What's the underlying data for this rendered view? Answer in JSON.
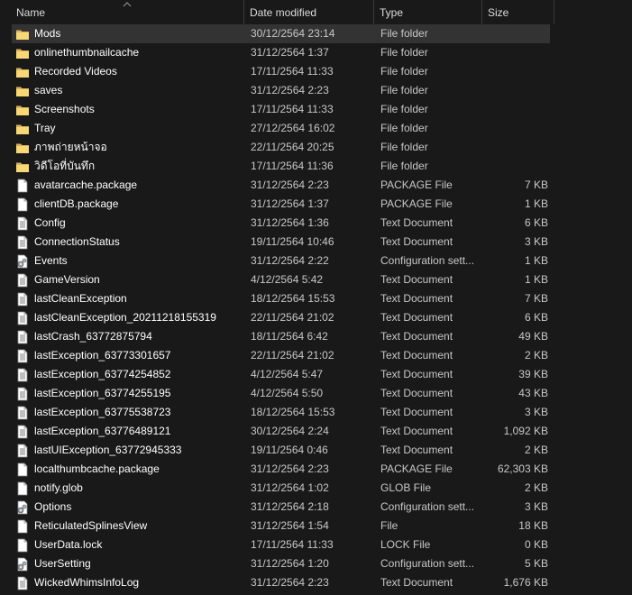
{
  "columns": {
    "name": "Name",
    "date": "Date modified",
    "type": "Type",
    "size": "Size"
  },
  "colors": {
    "background": "#191919",
    "selected_row": "#333333",
    "folder": "#f8d775",
    "file": "#ffffff"
  },
  "files": [
    {
      "name": "Mods",
      "date": "30/12/2564 23:14",
      "type": "File folder",
      "size": "",
      "icon": "folder-icon",
      "selected": true
    },
    {
      "name": "onlinethumbnailcache",
      "date": "31/12/2564 1:37",
      "type": "File folder",
      "size": "",
      "icon": "folder-icon"
    },
    {
      "name": "Recorded Videos",
      "date": "17/11/2564 11:33",
      "type": "File folder",
      "size": "",
      "icon": "folder-icon"
    },
    {
      "name": "saves",
      "date": "31/12/2564 2:23",
      "type": "File folder",
      "size": "",
      "icon": "folder-icon"
    },
    {
      "name": "Screenshots",
      "date": "17/11/2564 11:33",
      "type": "File folder",
      "size": "",
      "icon": "folder-icon"
    },
    {
      "name": "Tray",
      "date": "27/12/2564 16:02",
      "type": "File folder",
      "size": "",
      "icon": "folder-icon"
    },
    {
      "name": "ภาพถ่ายหน้าจอ",
      "date": "22/11/2564 20:25",
      "type": "File folder",
      "size": "",
      "icon": "folder-icon"
    },
    {
      "name": "วิดีโอที่บันทึก",
      "date": "17/11/2564 11:36",
      "type": "File folder",
      "size": "",
      "icon": "folder-icon"
    },
    {
      "name": "avatarcache.package",
      "date": "31/12/2564 2:23",
      "type": "PACKAGE File",
      "size": "7 KB",
      "icon": "file-icon"
    },
    {
      "name": "clientDB.package",
      "date": "31/12/2564 1:37",
      "type": "PACKAGE File",
      "size": "1 KB",
      "icon": "file-icon"
    },
    {
      "name": "Config",
      "date": "31/12/2564 1:36",
      "type": "Text Document",
      "size": "6 KB",
      "icon": "text-document-icon"
    },
    {
      "name": "ConnectionStatus",
      "date": "19/11/2564 10:46",
      "type": "Text Document",
      "size": "3 KB",
      "icon": "text-document-icon"
    },
    {
      "name": "Events",
      "date": "31/12/2564 2:22",
      "type": "Configuration sett...",
      "size": "1 KB",
      "icon": "config-file-icon"
    },
    {
      "name": "GameVersion",
      "date": "4/12/2564 5:42",
      "type": "Text Document",
      "size": "1 KB",
      "icon": "text-document-icon"
    },
    {
      "name": "lastCleanException",
      "date": "18/12/2564 15:53",
      "type": "Text Document",
      "size": "7 KB",
      "icon": "text-document-icon"
    },
    {
      "name": "lastCleanException_20211218155319",
      "date": "22/11/2564 21:02",
      "type": "Text Document",
      "size": "6 KB",
      "icon": "text-document-icon"
    },
    {
      "name": "lastCrash_63772875794",
      "date": "18/11/2564 6:42",
      "type": "Text Document",
      "size": "49 KB",
      "icon": "text-document-icon"
    },
    {
      "name": "lastException_63773301657",
      "date": "22/11/2564 21:02",
      "type": "Text Document",
      "size": "2 KB",
      "icon": "text-document-icon"
    },
    {
      "name": "lastException_63774254852",
      "date": "4/12/2564 5:47",
      "type": "Text Document",
      "size": "39 KB",
      "icon": "text-document-icon"
    },
    {
      "name": "lastException_63774255195",
      "date": "4/12/2564 5:50",
      "type": "Text Document",
      "size": "43 KB",
      "icon": "text-document-icon"
    },
    {
      "name": "lastException_63775538723",
      "date": "18/12/2564 15:53",
      "type": "Text Document",
      "size": "3 KB",
      "icon": "text-document-icon"
    },
    {
      "name": "lastException_63776489121",
      "date": "30/12/2564 2:24",
      "type": "Text Document",
      "size": "1,092 KB",
      "icon": "text-document-icon"
    },
    {
      "name": "lastUIException_63772945333",
      "date": "19/11/2564 0:46",
      "type": "Text Document",
      "size": "2 KB",
      "icon": "text-document-icon"
    },
    {
      "name": "localthumbcache.package",
      "date": "31/12/2564 2:23",
      "type": "PACKAGE File",
      "size": "62,303 KB",
      "icon": "file-icon"
    },
    {
      "name": "notify.glob",
      "date": "31/12/2564 1:02",
      "type": "GLOB File",
      "size": "2 KB",
      "icon": "file-icon"
    },
    {
      "name": "Options",
      "date": "31/12/2564 2:18",
      "type": "Configuration sett...",
      "size": "3 KB",
      "icon": "config-file-icon"
    },
    {
      "name": "ReticulatedSplinesView",
      "date": "31/12/2564 1:54",
      "type": "File",
      "size": "18 KB",
      "icon": "file-icon"
    },
    {
      "name": "UserData.lock",
      "date": "17/11/2564 11:33",
      "type": "LOCK File",
      "size": "0 KB",
      "icon": "file-icon"
    },
    {
      "name": "UserSetting",
      "date": "31/12/2564 1:20",
      "type": "Configuration sett...",
      "size": "5 KB",
      "icon": "config-file-icon"
    },
    {
      "name": "WickedWhimsInfoLog",
      "date": "31/12/2564 2:23",
      "type": "Text Document",
      "size": "1,676 KB",
      "icon": "text-document-icon"
    }
  ]
}
